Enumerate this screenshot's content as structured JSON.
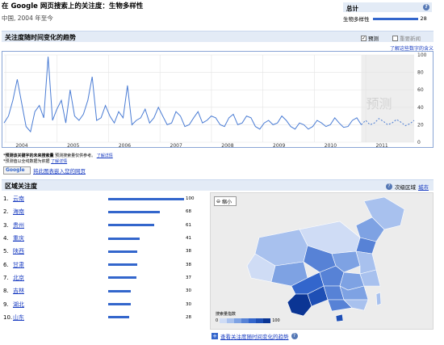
{
  "header": {
    "title": "在 Google 网页搜索上的关注度：生物多样性",
    "subtitle": "中国, 2004 年至今"
  },
  "summary": {
    "title": "总计",
    "help": "?",
    "term": "生物多样性",
    "value": "28",
    "fraction": 0.28
  },
  "trend": {
    "title": "关注度随时间变化的趋势",
    "forecast_label": "预测",
    "forecast_checked": true,
    "news_label": "重要新闻",
    "news_checked": false,
    "learn_more": "了解这些数字的含义",
    "watermark": "预测",
    "notes": {
      "line1_mark": "*",
      "line1_bold": "预测该关键字的未来搜索量",
      "line1": " 预测搜索量仅供参考。",
      "line1_link": "了解详情",
      "line2_mark": "*",
      "line2_bold": "",
      "line2": "预测值以全线数据为依据",
      "line2_link": "了解详情"
    },
    "gadget_button": "Google",
    "gadget_link": "将此图表嵌入您的网页"
  },
  "chart_data": {
    "type": "line",
    "x_ticks": [
      "2004",
      "2005",
      "2006",
      "2007",
      "2008",
      "2009",
      "2010",
      "2011"
    ],
    "y_ticks": [
      0,
      20,
      40,
      60,
      80,
      100
    ],
    "ylim": [
      0,
      100
    ],
    "series": [
      {
        "values": [
          22,
          30,
          48,
          72,
          45,
          18,
          12,
          35,
          42,
          28,
          98,
          25,
          38,
          48,
          22,
          60,
          30,
          25,
          32,
          48,
          75,
          25,
          28,
          42,
          30,
          22,
          35,
          28,
          65,
          20,
          25,
          28,
          38,
          22,
          28,
          40,
          30,
          20,
          22,
          35,
          30,
          18,
          20,
          28,
          35,
          22,
          25,
          30,
          28,
          20,
          18,
          28,
          32,
          20,
          22,
          30,
          28,
          18,
          15,
          22,
          25,
          20,
          22,
          30,
          25,
          18,
          15,
          22,
          20,
          15,
          18,
          25,
          22,
          18,
          20,
          28,
          22,
          17,
          18,
          25,
          28,
          20
        ]
      },
      {
        "style": "dashed",
        "values": [
          25,
          20,
          22,
          27,
          24,
          20,
          22,
          26,
          23,
          19,
          21,
          25
        ]
      }
    ]
  },
  "regional": {
    "title": "区域关注度",
    "help": "?",
    "subregion_label": "次级区域",
    "city_link": "城市",
    "regions": [
      {
        "rank": "1.",
        "name": "云南",
        "value": 100,
        "label": "100"
      },
      {
        "rank": "2.",
        "name": "海南",
        "value": 68,
        "label": "68"
      },
      {
        "rank": "3.",
        "name": "贵州",
        "value": 61,
        "label": "61"
      },
      {
        "rank": "4.",
        "name": "重庆",
        "value": 41,
        "label": "41"
      },
      {
        "rank": "5.",
        "name": "陕西",
        "value": 38,
        "label": "38"
      },
      {
        "rank": "6.",
        "name": "甘肃",
        "value": 38,
        "label": "38"
      },
      {
        "rank": "7.",
        "name": "北京",
        "value": 37,
        "label": "37"
      },
      {
        "rank": "8.",
        "name": "吉林",
        "value": 30,
        "label": "30"
      },
      {
        "rank": "9.",
        "name": "湖北",
        "value": 30,
        "label": "30"
      },
      {
        "rank": "10.",
        "name": "山东",
        "value": 28,
        "label": "28"
      }
    ],
    "zoom_out": "缩小",
    "legend_title": "搜索量指数",
    "legend_min": "0",
    "legend_max": "100",
    "colors": [
      "#cfdcf5",
      "#a8c1ee",
      "#7ea2e3",
      "#5782d6",
      "#3366cc",
      "#1e4fb5",
      "#0b3594"
    ],
    "see_trend_link": "查看关注度随时间变化的趋势"
  }
}
